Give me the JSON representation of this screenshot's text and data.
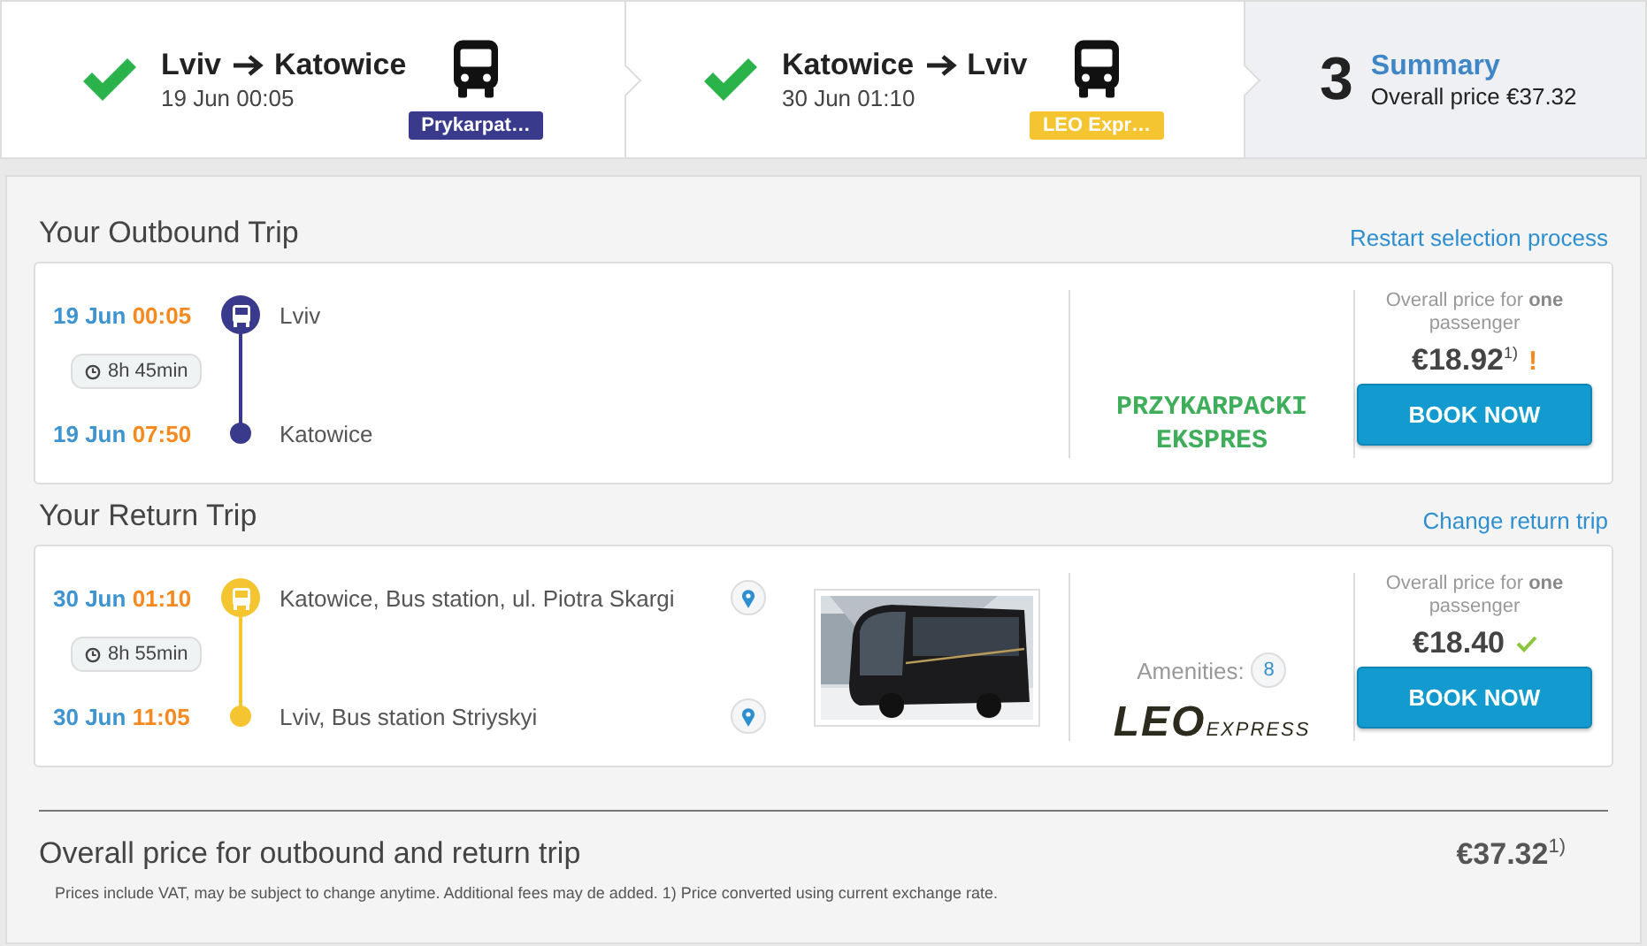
{
  "steps": [
    {
      "kind": "done",
      "from": "Lviv",
      "to": "Katowice",
      "date": "19 Jun 00:05",
      "badge": {
        "label": "Prykarpat…",
        "color": "#3a3a8c"
      }
    },
    {
      "kind": "done",
      "from": "Katowice",
      "to": "Lviv",
      "date": "30 Jun 01:10",
      "badge": {
        "label": "LEO Expr…",
        "color": "#f5c431"
      }
    },
    {
      "kind": "number",
      "number": "3",
      "title": "Summary",
      "subtitle": "Overall price €37.32"
    }
  ],
  "trips": [
    {
      "heading": "Your Outbound Trip",
      "link": "Restart selection process",
      "color": "#3a3a8c",
      "duration": "8h 45min",
      "photo": false,
      "stops": [
        {
          "date": "19 Jun",
          "time": "00:05",
          "place": "Lviv",
          "pin": false
        },
        {
          "date": "19 Jun",
          "time": "07:50",
          "place": "Katowice",
          "pin": false
        }
      ],
      "vendor": {
        "kind": "text",
        "lines": [
          "PRZYKARPACKI",
          "EKSPRES"
        ]
      },
      "price_label": "Overall price for **one** passenger",
      "price": "€18.92$^{1)}$",
      "price_note": {
        "kind": "warning",
        "text": "!"
      },
      "button": "BOOK NOW"
    },
    {
      "heading": "Your Return Trip",
      "link": "Change return trip",
      "color": "#f5c431",
      "duration": "8h 55min",
      "photo": true,
      "stops": [
        {
          "date": "30 Jun",
          "time": "01:10",
          "place": "Katowice, Bus station, ul. Piotra Skargi",
          "pin": true
        },
        {
          "date": "30 Jun",
          "time": "11:05",
          "place": "Lviv, Bus station Striyskyi",
          "pin": true
        }
      ],
      "vendor": {
        "kind": "leo",
        "amenities_label": "Amenities:",
        "amenities_count": "8",
        "logo_main": "LEO",
        "logo_sub": "EXPRESS"
      },
      "price_label": "Overall price for **one** passenger",
      "price": "€18.40",
      "price_note": {
        "kind": "ok"
      },
      "button": "BOOK NOW"
    }
  ],
  "total": {
    "label": "Overall price for outbound and return trip",
    "price": "€37.32$^{1)}$",
    "note": "Prices include VAT, may be subject to change anytime. Additional fees may de added. 1) Price converted using current exchange rate."
  }
}
